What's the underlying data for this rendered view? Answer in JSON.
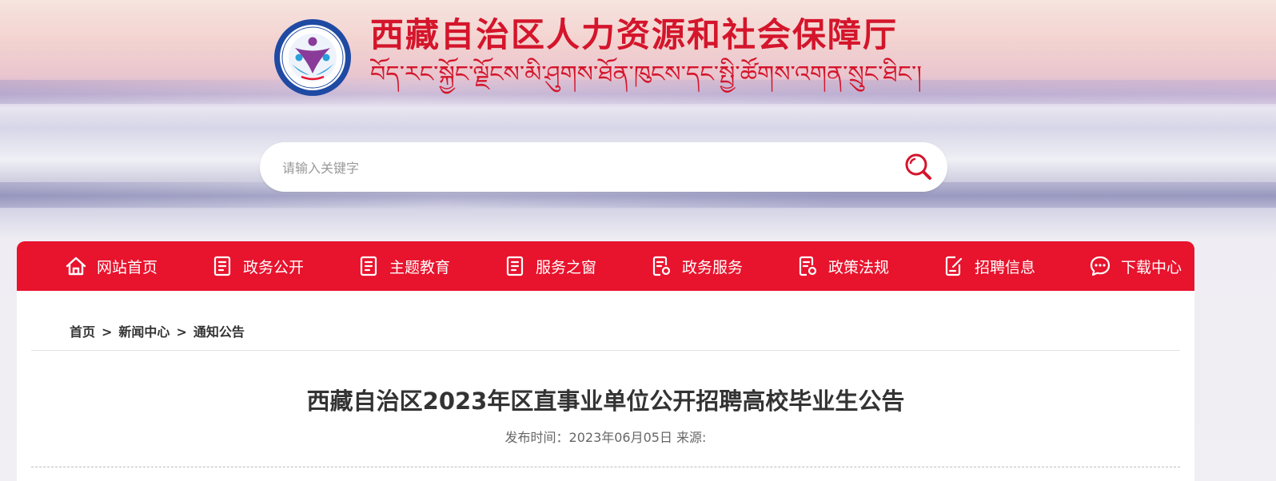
{
  "header": {
    "site_title": "西藏自治区人力资源和社会保障厅",
    "site_title_tibetan": "བོད་རང་སྐྱོང་ལྗོངས་མི་ཤུགས་ཐོན་ཁུངས་དང་སྤྱི་ཚོགས་འགན་སྲུང་ཐིང་།"
  },
  "search": {
    "placeholder": "请输入关键字"
  },
  "nav": {
    "items": [
      {
        "label": "网站首页",
        "icon": "home-icon"
      },
      {
        "label": "政务公开",
        "icon": "document-icon"
      },
      {
        "label": "主题教育",
        "icon": "document-icon"
      },
      {
        "label": "服务之窗",
        "icon": "document-icon"
      },
      {
        "label": "政务服务",
        "icon": "document-settings-icon"
      },
      {
        "label": "政策法规",
        "icon": "document-settings-icon"
      },
      {
        "label": "招聘信息",
        "icon": "edit-document-icon"
      },
      {
        "label": "下载中心",
        "icon": "chat-icon"
      }
    ]
  },
  "breadcrumb": {
    "items": [
      "首页",
      "新闻中心",
      "通知公告"
    ],
    "separator": ">"
  },
  "article": {
    "title": "西藏自治区2023年区直事业单位公开招聘高校毕业生公告",
    "meta": "发布时间：2023年06月05日 来源:"
  },
  "colors": {
    "brand_red": "#e8132d",
    "title_red": "#d4152b"
  }
}
